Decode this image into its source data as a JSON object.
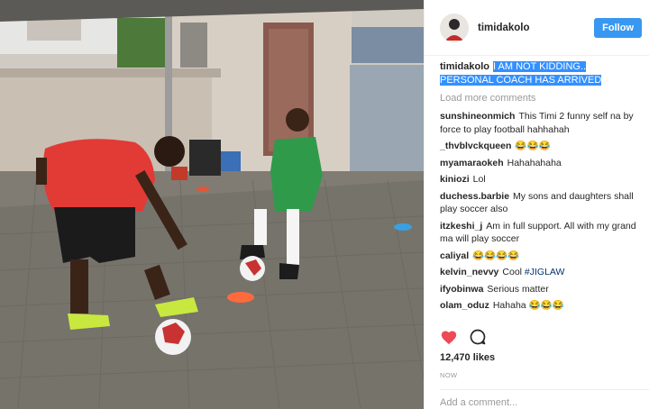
{
  "post": {
    "username": "timidakolo",
    "follow_label": "Follow",
    "caption_user": "timidakolo",
    "caption_text": "I AM NOT KIDDING.. PERSONAL COACH HAS ARRIVED",
    "load_more": "Load more comments",
    "comments": [
      {
        "user": "sunshineonmich",
        "text": "This Timi 2 funny self na by force to play football hahhahah"
      },
      {
        "user": "_thvblvckqueen",
        "text": "😂😂😂"
      },
      {
        "user": "myamaraokeh",
        "text": "Hahahahaha"
      },
      {
        "user": "kiniozi",
        "text": "Lol"
      },
      {
        "user": "duchess.barbie",
        "text": "My sons and daughters shall play soccer also"
      },
      {
        "user": "itzkeshi_j",
        "text": "Am in full support. All with my grand ma will play soccer"
      },
      {
        "user": "caliyal",
        "text": "😂😂😂😂"
      },
      {
        "user": "kelvin_nevvy",
        "text": "Cool ",
        "tag": "#JIGLAW"
      },
      {
        "user": "ifyobinwa",
        "text": "Serious matter"
      },
      {
        "user": "olam_oduz",
        "text": "Hahaha 😂😂😂"
      }
    ],
    "likes": "12,470 likes",
    "timestamp": "NOW",
    "add_comment_placeholder": "Add a comment...",
    "heart_color": "#ed4956",
    "accent_color": "#3897f0"
  },
  "icons": {
    "like": "heart-icon",
    "comment": "comment-bubble-icon"
  }
}
